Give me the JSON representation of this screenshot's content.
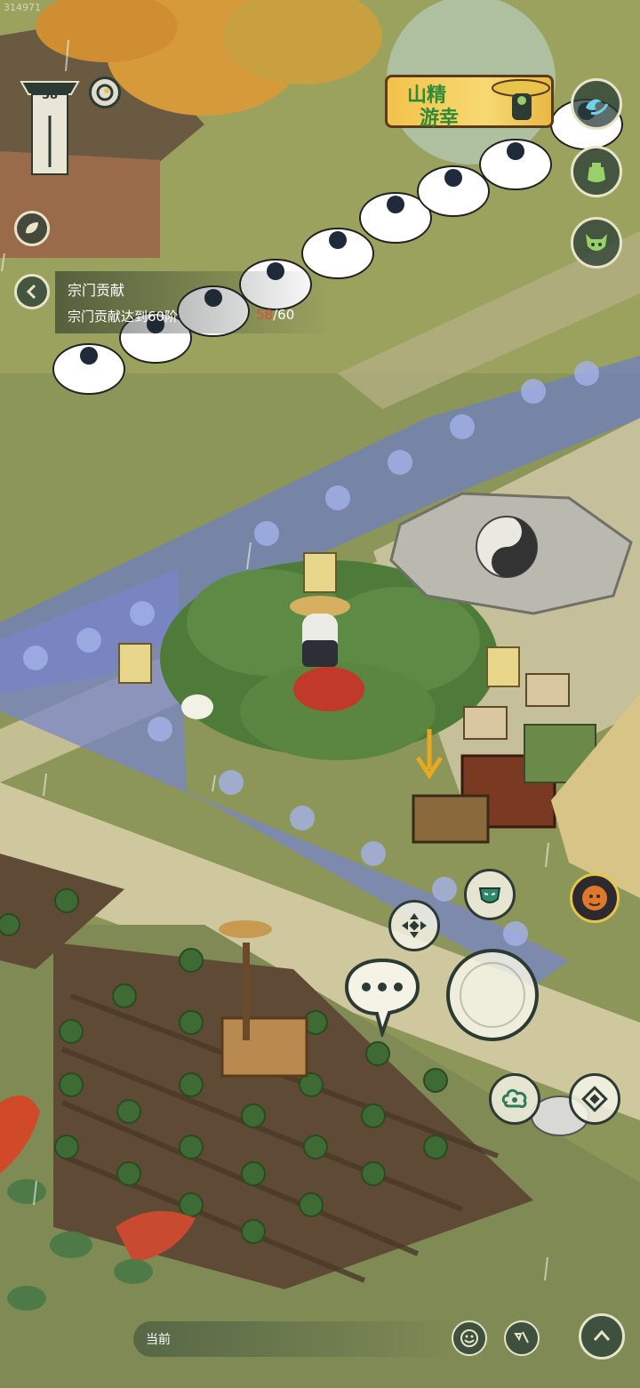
{
  "watermark": "314971",
  "level_badge": {
    "value": "58"
  },
  "quest": {
    "title": "宗门贡献",
    "description": "宗门贡献达到60阶",
    "progress_current": "58",
    "progress_total": "/60"
  },
  "event_banner": {
    "line1": "山精",
    "line2": "游幸"
  },
  "right_menu": [
    {
      "icon": "wave-icon"
    },
    {
      "icon": "pot-icon"
    },
    {
      "icon": "demon-mask-icon"
    }
  ],
  "left_menu": [
    {
      "icon": "leaf-icon"
    },
    {
      "icon": "collapse-arrow-icon"
    }
  ],
  "controls": {
    "move_icon": "dpad-icon",
    "chat_icon": "speech-bubble-icon",
    "action_icon": "empty-action-icon",
    "emote_icon": "mask-icon",
    "skill_left_icon": "cloud-icon",
    "skill_right_icon": "compass-icon",
    "portrait_icon": "monk-portrait-icon"
  },
  "bottom_bar": {
    "label": "当前"
  },
  "bottom_icons": [
    {
      "icon": "smile-icon"
    },
    {
      "icon": "brush-icon"
    },
    {
      "icon": "chevron-up-icon"
    }
  ],
  "colors": {
    "quest_progress_current": "#e04a3a",
    "banner_gold": "#f2c24a",
    "button_dark": "#2c3a34"
  }
}
